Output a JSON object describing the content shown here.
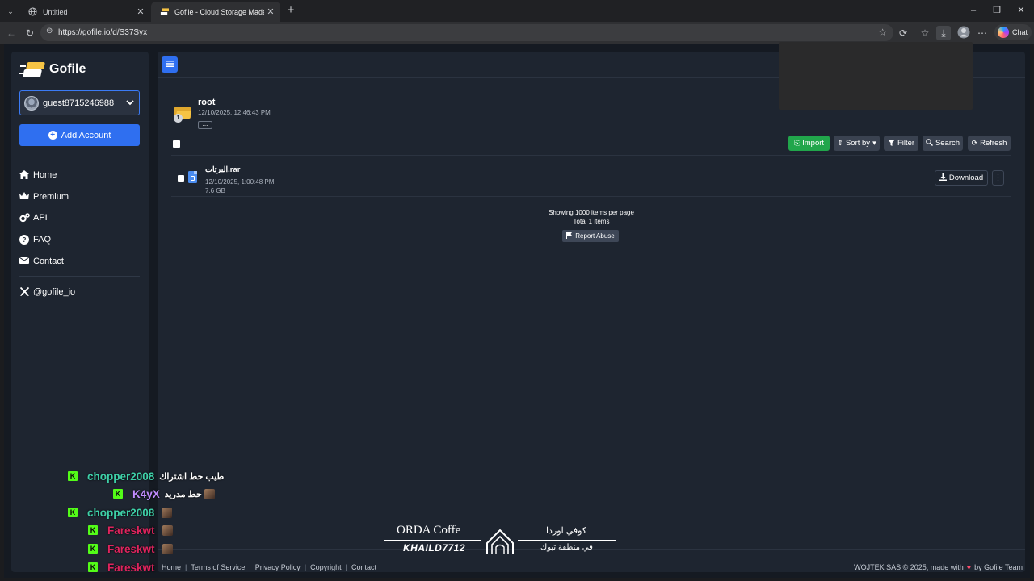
{
  "browser": {
    "tabs": [
      {
        "title": "Untitled"
      },
      {
        "title": "Gofile - Cloud Storage Made Simple"
      }
    ],
    "url": "https://gofile.io/d/S37Syx",
    "chat_label": "Chat"
  },
  "sidebar": {
    "brand": "Gofile",
    "account": "guest8715246988",
    "add_account": "Add Account",
    "nav": [
      {
        "label": "Home",
        "icon": "home-icon"
      },
      {
        "label": "Premium",
        "icon": "crown-icon"
      },
      {
        "label": "API",
        "icon": "gears-icon"
      },
      {
        "label": "FAQ",
        "icon": "question-icon"
      },
      {
        "label": "Contact",
        "icon": "envelope-icon"
      }
    ],
    "social": "@gofile_io"
  },
  "folder": {
    "name": "root",
    "date": "12/10/2025, 12:46:43 PM",
    "badge": "1",
    "more": "..."
  },
  "actions": {
    "import": "Import",
    "sort": "Sort by",
    "filter": "Filter",
    "search": "Search",
    "refresh": "Refresh"
  },
  "files": [
    {
      "name": "البرتات.rar",
      "date": "12/10/2025, 1:00:48 PM",
      "size": "7.6 GB",
      "download": "Download"
    }
  ],
  "pagination": {
    "per_page": "Showing 1000 items per page",
    "total": "Total 1 items",
    "report": "Report Abuse"
  },
  "footer": {
    "links": [
      "Home",
      "Terms of Service",
      "Privacy Policy",
      "Copyright",
      "Contact"
    ],
    "copyright_prefix": "WOJTEK SAS © 2025, made with",
    "copyright_suffix": "by Gofile Team"
  },
  "chat": [
    {
      "user": "chopper2008",
      "message": "طيب حط اشتراك",
      "color": "#3ed0a8"
    },
    {
      "user": "K4yX",
      "message": "حط مدريد",
      "color": "#c18cff"
    },
    {
      "user": "chopper2008",
      "message": "",
      "color": "#3ed0a8"
    },
    {
      "user": "Fareskwt",
      "message": "",
      "color": "#e0245e"
    },
    {
      "user": "Fareskwt",
      "message": "",
      "color": "#e0245e"
    },
    {
      "user": "Fareskwt",
      "message": "",
      "color": "#e0245e"
    }
  ],
  "overlay": {
    "title": "ORDA Coffe",
    "handle": "KHAILD7712",
    "arabic_top": "كوفي اوردا",
    "arabic_bottom": "في منطقة تبوك"
  },
  "colors": {
    "accent": "#2f6ff0",
    "import": "#21a64b",
    "kick": "#53fc18"
  }
}
